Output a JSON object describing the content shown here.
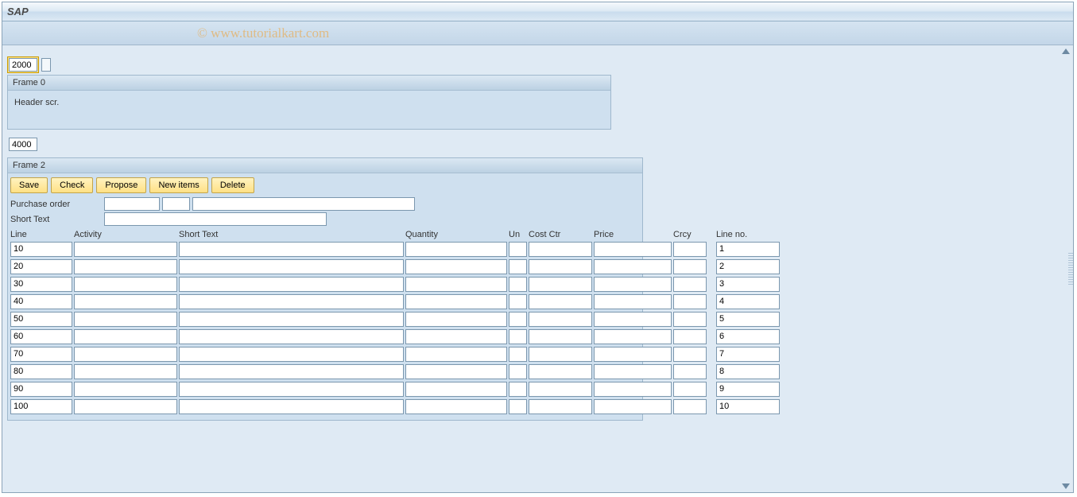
{
  "title": "SAP",
  "watermark": "© www.tutorialkart.com",
  "field_above_frame0": "2000",
  "frame0": {
    "title": "Frame 0",
    "header_label": "Header scr."
  },
  "field_above_frame2": "4000",
  "frame2": {
    "title": "Frame 2",
    "buttons": {
      "save": "Save",
      "check": "Check",
      "propose": "Propose",
      "new_items": "New items",
      "delete": "Delete"
    },
    "purchase_order_label": "Purchase order",
    "purchase_order_value1": "",
    "purchase_order_value2": "",
    "purchase_order_value3": "",
    "short_text_label": "Short Text",
    "short_text_value": "",
    "columns": {
      "line": "Line",
      "activity": "Activity",
      "short_text": "Short Text",
      "quantity": "Quantity",
      "un": "Un",
      "cost_ctr": "Cost Ctr",
      "price": "Price",
      "crcy": "Crcy",
      "line_no": "Line no."
    },
    "rows": [
      {
        "line": "10",
        "activity": "",
        "short_text": "",
        "quantity": "",
        "un": "",
        "cost_ctr": "",
        "price": "",
        "crcy": "",
        "line_no": "1"
      },
      {
        "line": "20",
        "activity": "",
        "short_text": "",
        "quantity": "",
        "un": "",
        "cost_ctr": "",
        "price": "",
        "crcy": "",
        "line_no": "2"
      },
      {
        "line": "30",
        "activity": "",
        "short_text": "",
        "quantity": "",
        "un": "",
        "cost_ctr": "",
        "price": "",
        "crcy": "",
        "line_no": "3"
      },
      {
        "line": "40",
        "activity": "",
        "short_text": "",
        "quantity": "",
        "un": "",
        "cost_ctr": "",
        "price": "",
        "crcy": "",
        "line_no": "4"
      },
      {
        "line": "50",
        "activity": "",
        "short_text": "",
        "quantity": "",
        "un": "",
        "cost_ctr": "",
        "price": "",
        "crcy": "",
        "line_no": "5"
      },
      {
        "line": "60",
        "activity": "",
        "short_text": "",
        "quantity": "",
        "un": "",
        "cost_ctr": "",
        "price": "",
        "crcy": "",
        "line_no": "6"
      },
      {
        "line": "70",
        "activity": "",
        "short_text": "",
        "quantity": "",
        "un": "",
        "cost_ctr": "",
        "price": "",
        "crcy": "",
        "line_no": "7"
      },
      {
        "line": "80",
        "activity": "",
        "short_text": "",
        "quantity": "",
        "un": "",
        "cost_ctr": "",
        "price": "",
        "crcy": "",
        "line_no": "8"
      },
      {
        "line": "90",
        "activity": "",
        "short_text": "",
        "quantity": "",
        "un": "",
        "cost_ctr": "",
        "price": "",
        "crcy": "",
        "line_no": "9"
      },
      {
        "line": "100",
        "activity": "",
        "short_text": "",
        "quantity": "",
        "un": "",
        "cost_ctr": "",
        "price": "",
        "crcy": "",
        "line_no": "10"
      }
    ]
  }
}
